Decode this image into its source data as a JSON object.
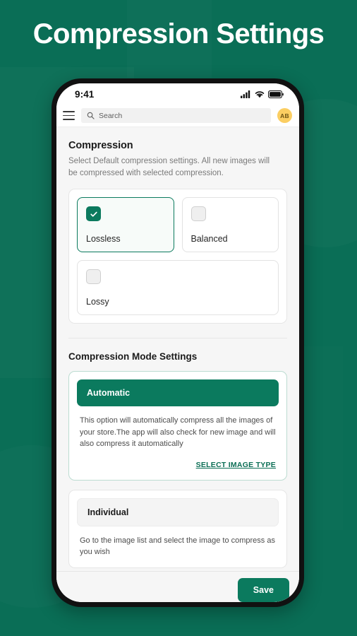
{
  "page": {
    "title": "Compression Settings",
    "background_color": "#0a6e56",
    "accent_color": "#0b7a5e"
  },
  "status_bar": {
    "time": "9:41",
    "icons": [
      "signal-icon",
      "wifi-icon",
      "battery-icon"
    ]
  },
  "toolbar": {
    "menu_icon": "hamburger-menu-icon",
    "search_placeholder": "Search",
    "search_value": "",
    "search_icon": "search-icon",
    "avatar_initials": "AB"
  },
  "compression": {
    "heading": "Compression",
    "subtitle": "Select Default compression settings. All new images will be compressed with selected compression.",
    "options": [
      {
        "label": "Lossless",
        "checked": true
      },
      {
        "label": "Balanced",
        "checked": false
      },
      {
        "label": "Lossy",
        "checked": false
      }
    ]
  },
  "mode_settings": {
    "heading": "Compression Mode Settings",
    "modes": [
      {
        "label": "Automatic",
        "active": true,
        "description": "This option will automatically compress all the images of your store.The app will also check for new image and will also compress it automatically",
        "link_label": "SELECT IMAGE TYPE"
      },
      {
        "label": "Individual",
        "active": false,
        "description": "Go to the image list and select the image to compress as you wish",
        "link_label": ""
      }
    ]
  },
  "footer": {
    "save_label": "Save"
  }
}
